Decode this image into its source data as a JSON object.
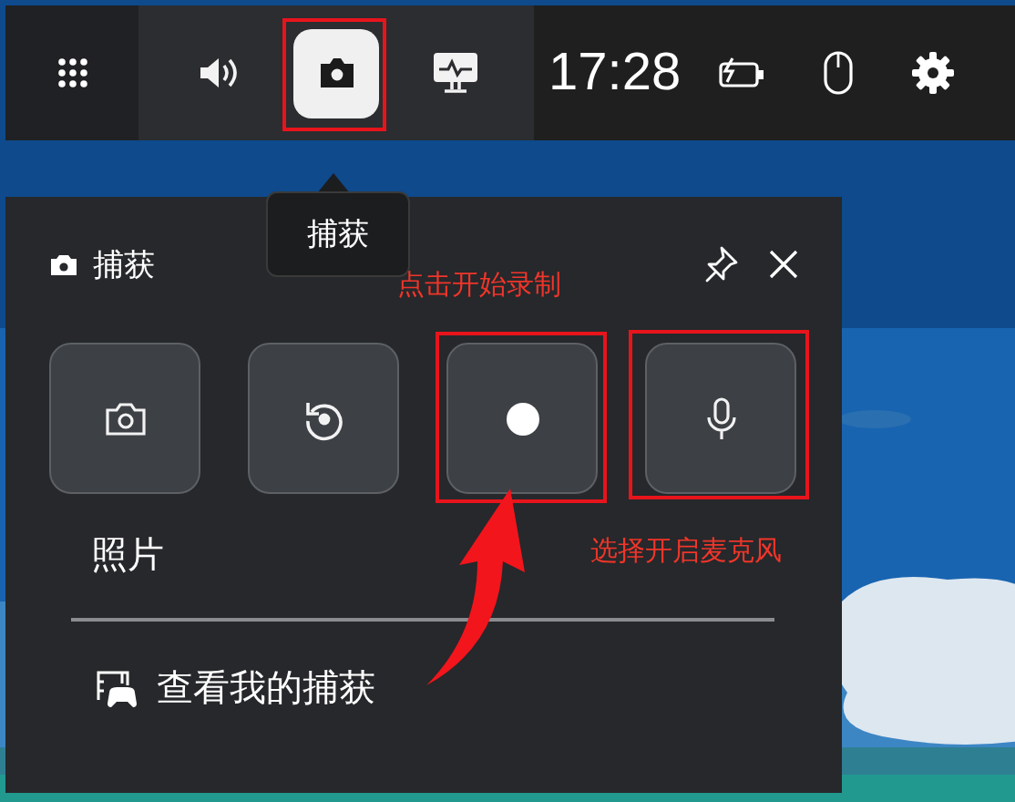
{
  "top_bar": {
    "tools": [
      {
        "kind": "audio",
        "selected": false
      },
      {
        "kind": "capture",
        "selected": true
      },
      {
        "kind": "performance",
        "selected": false
      }
    ],
    "time": "17:28"
  },
  "tooltip": {
    "text": "捕获"
  },
  "capture_panel": {
    "title": "捕获",
    "actions": [
      {
        "kind": "screenshot"
      },
      {
        "kind": "record_last"
      },
      {
        "kind": "record"
      },
      {
        "kind": "microphone"
      }
    ],
    "caption": "照片",
    "link": "查看我的捕获"
  },
  "annotations": [
    {
      "text": "点击开始录制"
    },
    {
      "text": "选择开启麦克风"
    }
  ]
}
